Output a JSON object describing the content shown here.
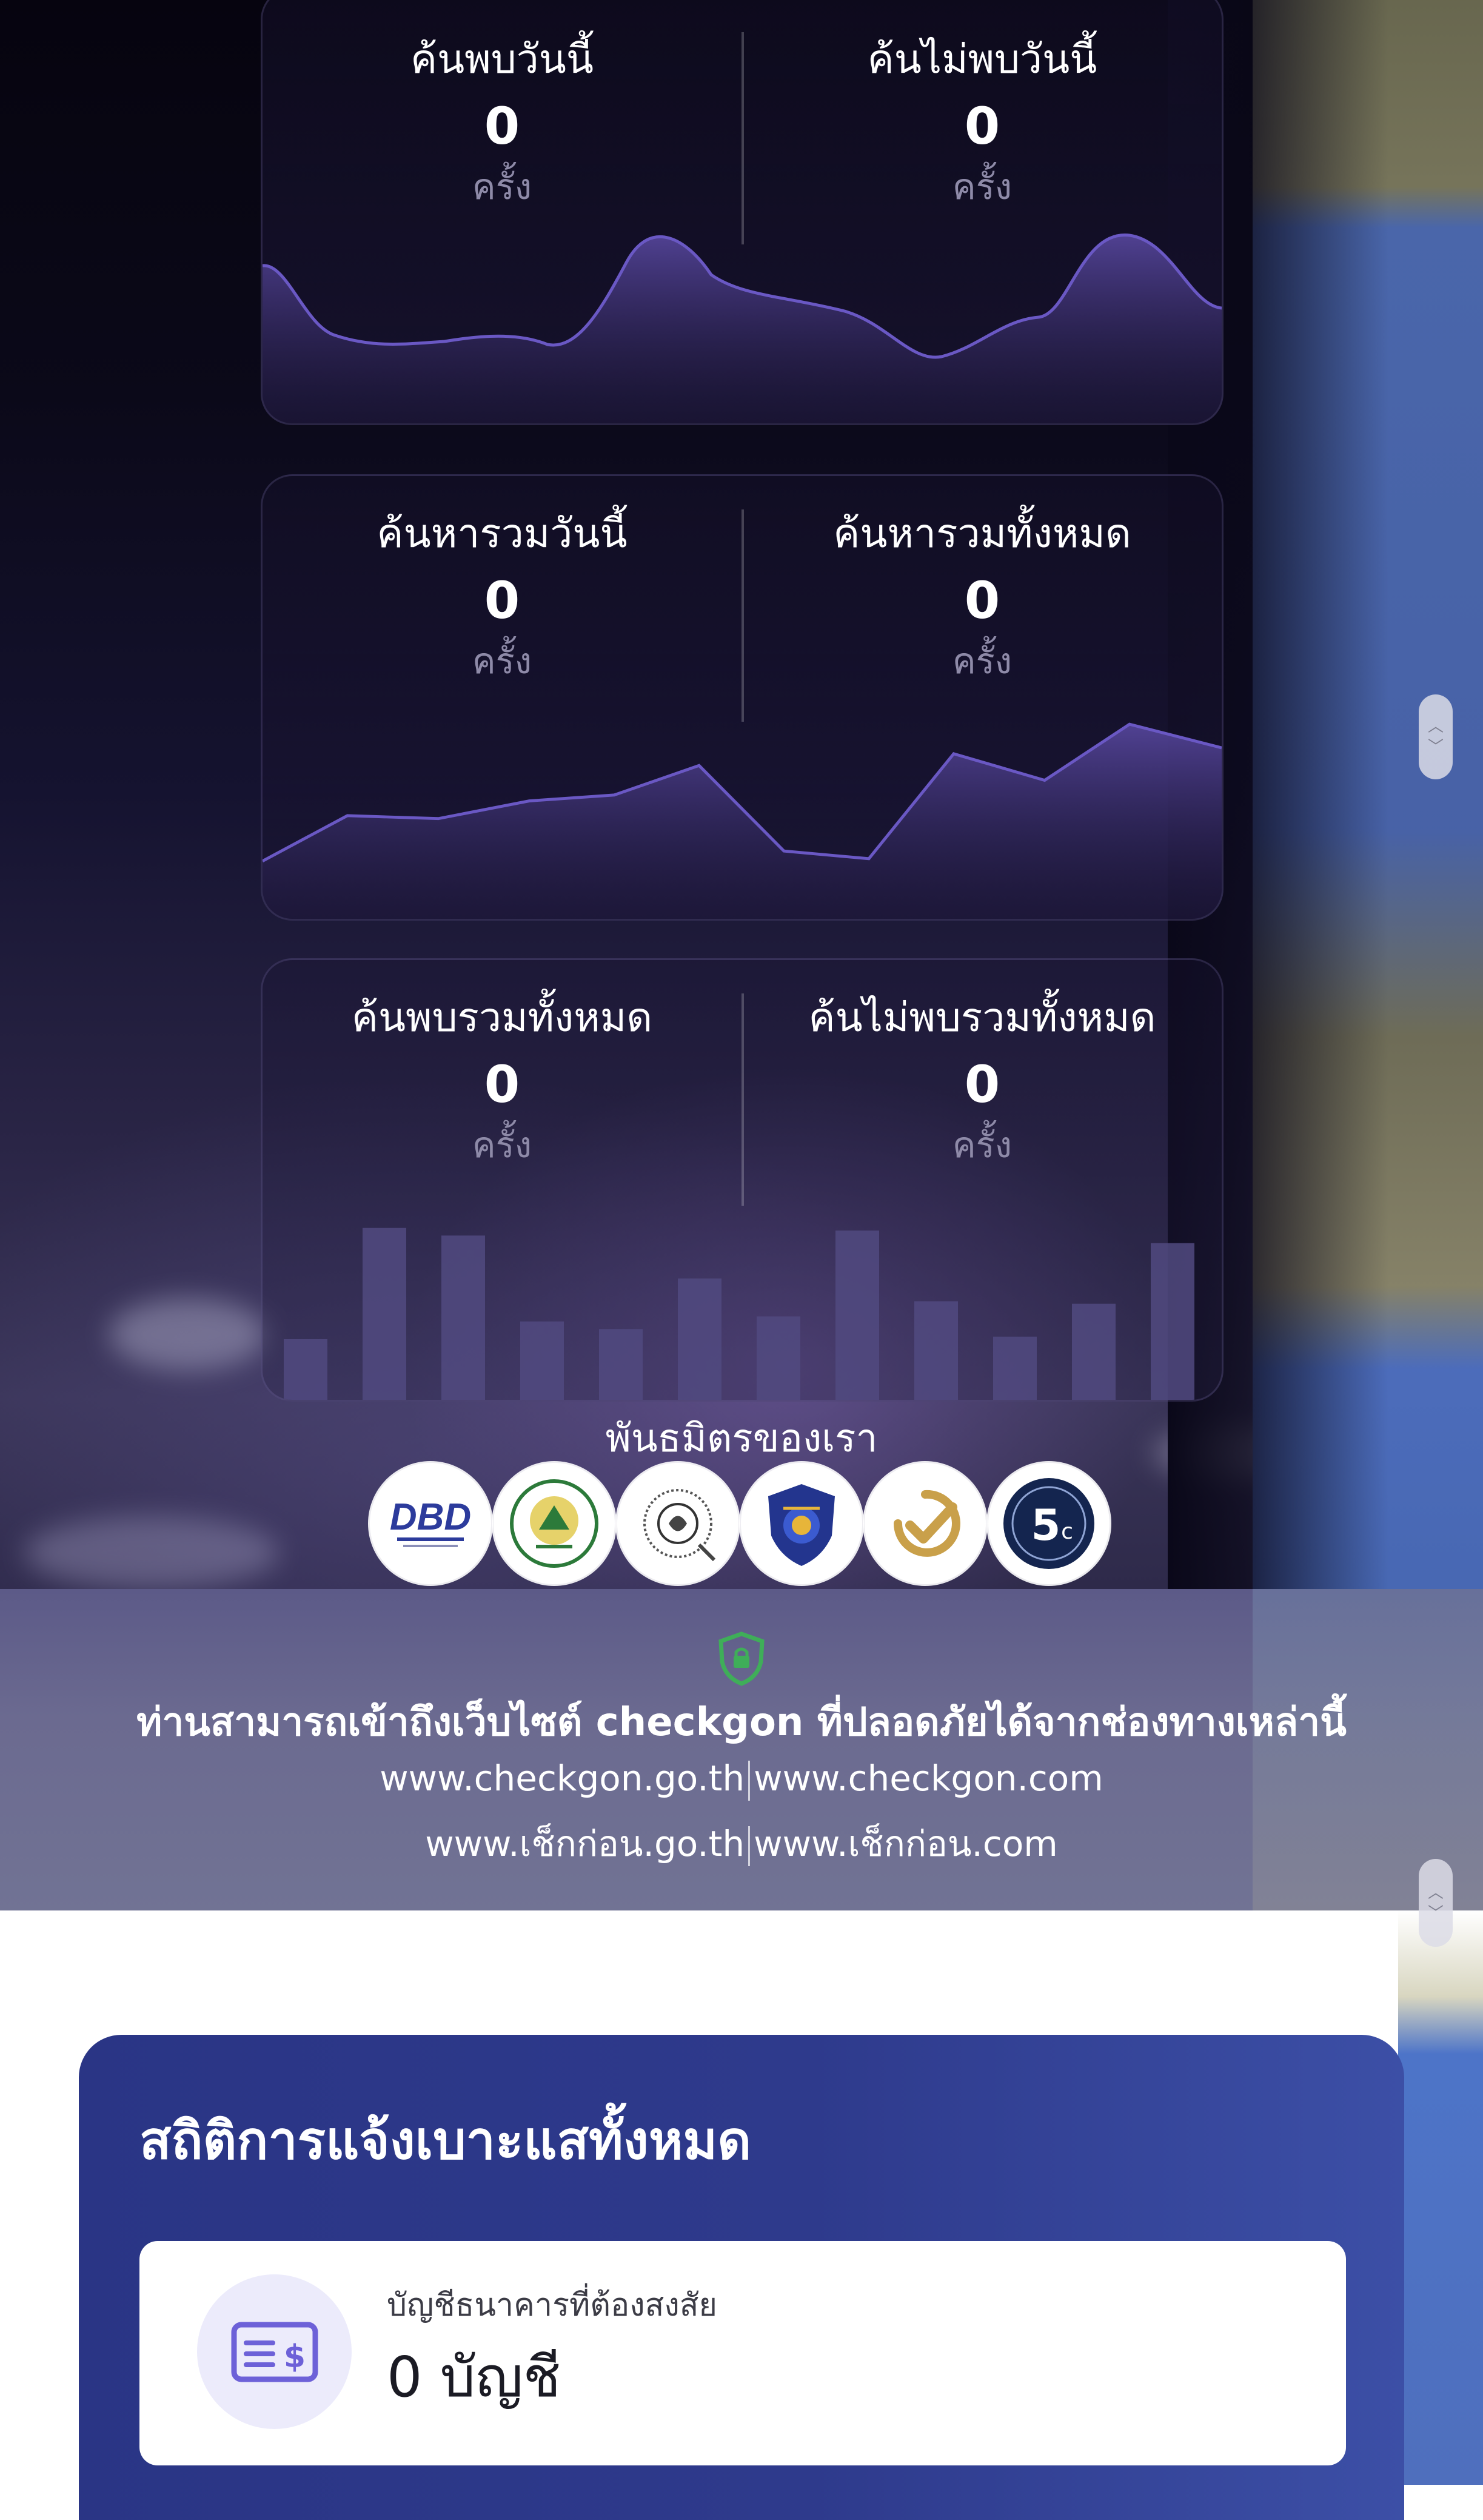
{
  "stats": {
    "unit": "ครั้ง",
    "card1": {
      "left": {
        "label": "ค้นพบวันนี้",
        "value": "0",
        "unit": "ครั้ง"
      },
      "right": {
        "label": "ค้นไม่พบวันนี้",
        "value": "0",
        "unit": "ครั้ง"
      }
    },
    "card2": {
      "left": {
        "label": "ค้นหารวมวันนี้",
        "value": "0",
        "unit": "ครั้ง"
      },
      "right": {
        "label": "ค้นหารวมทั้งหมด",
        "value": "0",
        "unit": "ครั้ง"
      }
    },
    "card3": {
      "left": {
        "label": "ค้นพบรวมทั้งหมด",
        "value": "0",
        "unit": "ครั้ง"
      },
      "right": {
        "label": "ค้นไม่พบรวมทั้งหมด",
        "value": "0",
        "unit": "ครั้ง"
      }
    }
  },
  "partners": {
    "title": "พันธมิตรของเรา",
    "logos": [
      "DBD",
      "government-seal",
      "thai-seal",
      "police-badge",
      "check-badge",
      "5G"
    ]
  },
  "safety": {
    "icon": "shield-lock-icon",
    "title": "ท่านสามารถเข้าถึงเว็บไซต์ checkgon ที่ปลอดภัยได้จากช่องทางเหล่านี้",
    "links_row1": [
      "www.checkgon.go.th",
      "www.checkgon.com"
    ],
    "links_row2": [
      "www.เช็กก่อน.go.th",
      "www.เช็กก่อน.com"
    ]
  },
  "report": {
    "title": "สถิติการแจ้งเบาะแสทั้งหมด",
    "card": {
      "icon": "bank-bill-icon",
      "label": "บัญชีธนาคารที่ต้องสงสัย",
      "value": "0 บัญชี"
    }
  },
  "colors": {
    "accent_purple": "#5a4aa8",
    "panel_blue": "#2c3788",
    "shield_green": "#3fae59"
  }
}
